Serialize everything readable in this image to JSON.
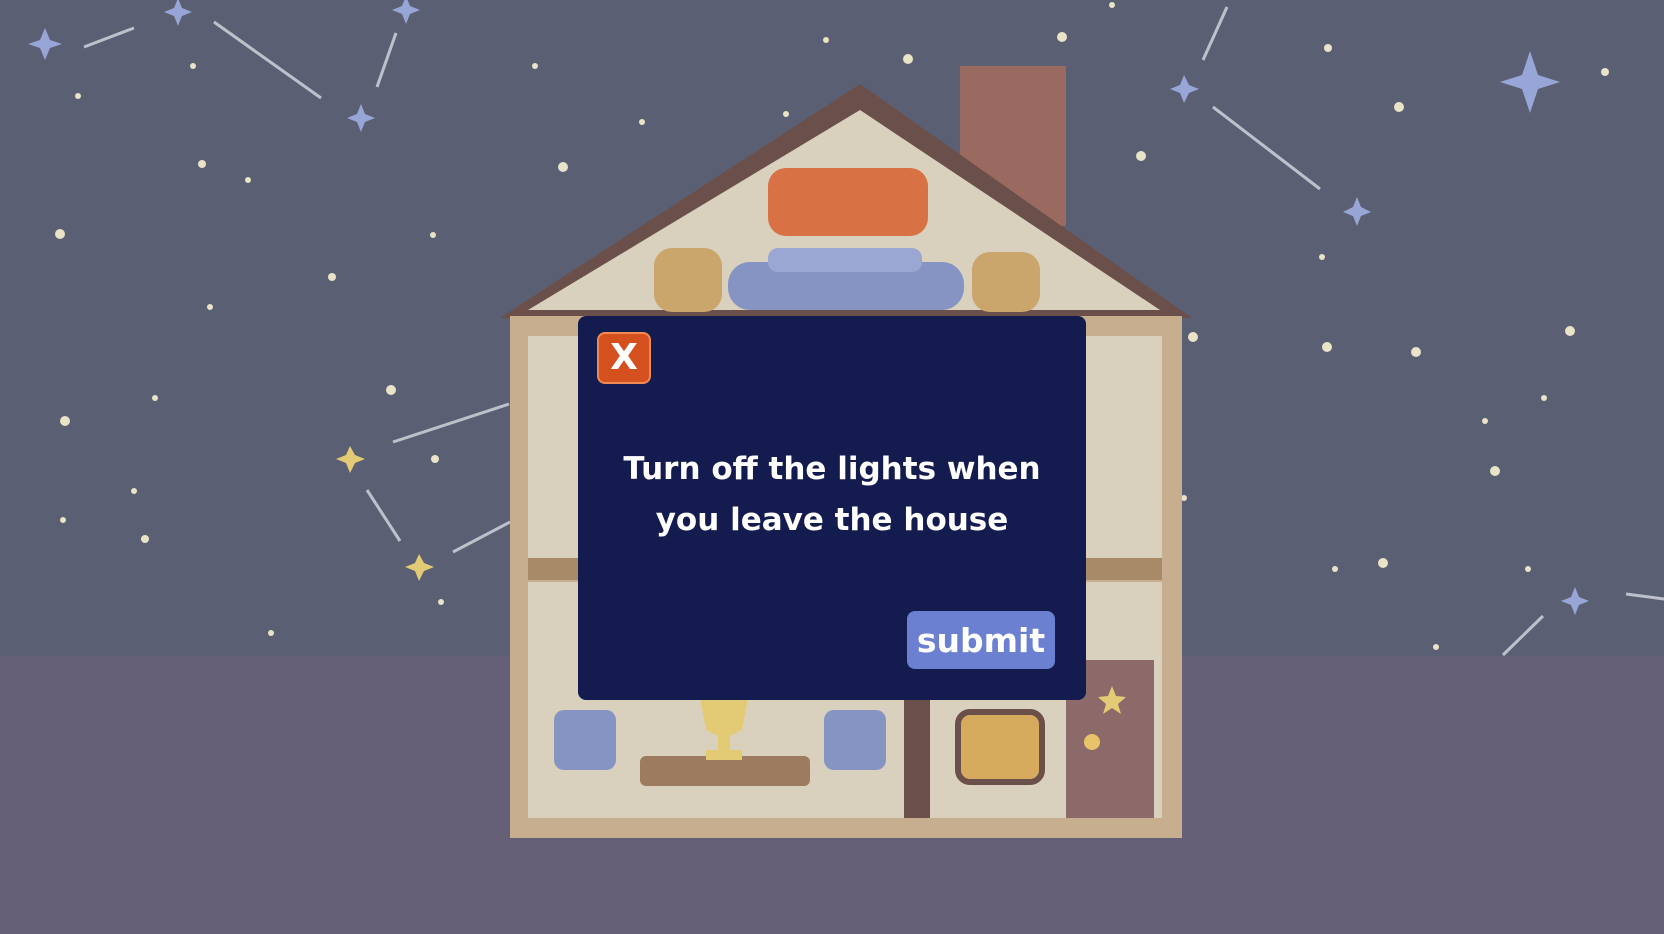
{
  "dialog": {
    "close_label": "X",
    "message": "Turn off the lights when you leave the house",
    "submit_label": "submit"
  },
  "colors": {
    "sky": "#5b5f74",
    "ground": "#655f77",
    "dialog_bg": "#141c4f",
    "close_bg": "#d5501f",
    "submit_bg": "#6c80d2"
  }
}
